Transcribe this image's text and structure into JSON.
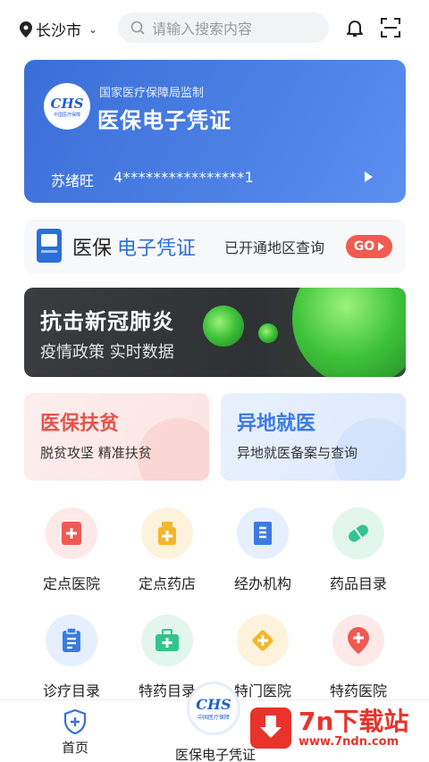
{
  "header": {
    "city": "长沙市",
    "search_placeholder": "请输入搜索内容"
  },
  "card": {
    "logo_text": "CHS",
    "logo_subtext": "中国医疗保障",
    "supervisor": "国家医疗保障局监制",
    "title": "医保电子凭证",
    "holder_name": "苏绪旺",
    "id_number": "4****************1"
  },
  "query": {
    "label_black": "医保",
    "label_blue": "电子凭证",
    "subtitle": "已开通地区查询",
    "go_label": "GO"
  },
  "banner": {
    "title": "抗击新冠肺炎",
    "subtitle": "疫情政策  实时数据"
  },
  "tiles": [
    {
      "title": "医保扶贫",
      "subtitle": "脱贫攻坚 精准扶贫"
    },
    {
      "title": "异地就医",
      "subtitle": "异地就医备案与查询"
    }
  ],
  "grid": [
    {
      "label": "定点医院",
      "icon": "hospital-icon",
      "bg": "#fde9e8",
      "fg": "#ef5a52"
    },
    {
      "label": "定点药店",
      "icon": "pharmacy-icon",
      "bg": "#fdf3dc",
      "fg": "#f5b62a"
    },
    {
      "label": "经办机构",
      "icon": "building-icon",
      "bg": "#e5efff",
      "fg": "#3b7be0"
    },
    {
      "label": "药品目录",
      "icon": "pill-icon",
      "bg": "#e2f6ee",
      "fg": "#34c48b"
    },
    {
      "label": "诊疗目录",
      "icon": "clipboard-icon",
      "bg": "#e5efff",
      "fg": "#3b7be0"
    },
    {
      "label": "特药目录",
      "icon": "medkit-icon",
      "bg": "#e2f6ee",
      "fg": "#34c48b"
    },
    {
      "label": "特门医院",
      "icon": "diamond-plus-icon",
      "bg": "#fdf3dc",
      "fg": "#f5b62a"
    },
    {
      "label": "特药医院",
      "icon": "map-pin-plus-icon",
      "bg": "#fde9e8",
      "fg": "#ef5a52"
    }
  ],
  "tabbar": {
    "home": "首页",
    "voucher": "医保电子凭证"
  },
  "watermark": {
    "brand": "7n下载站",
    "url": "www.7ndn.com"
  },
  "colors": {
    "accent_blue": "#3b6fd8",
    "go_red": "#f25b4f"
  }
}
